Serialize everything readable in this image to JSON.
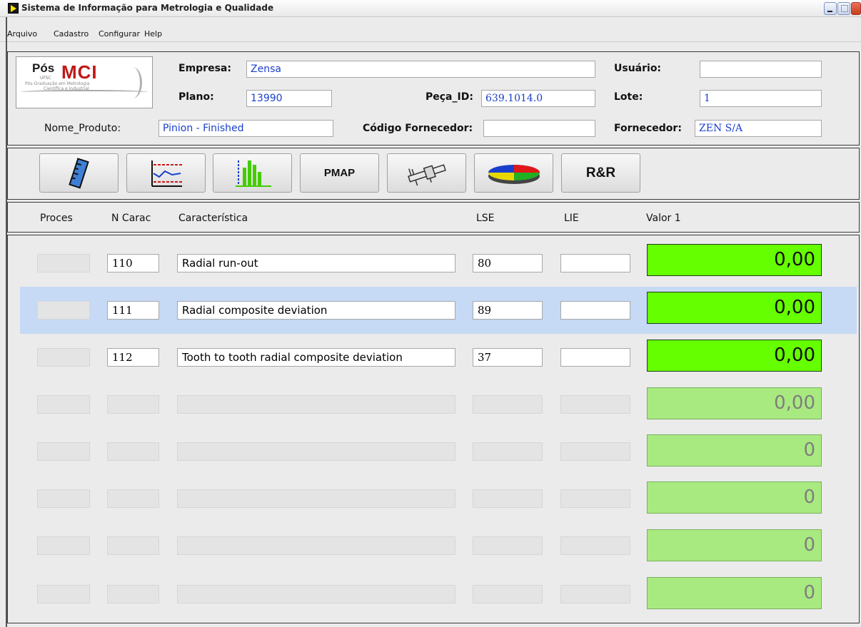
{
  "window": {
    "title": "Sistema de Informação para Metrologia e Qualidade"
  },
  "menu": [
    "Arquivo",
    "Cadastro",
    "Configurar",
    "Help"
  ],
  "logo": {
    "pos": "Pós",
    "mci": "MCI",
    "ufsc": "UFSC",
    "line1": "Pós-Graduação em Metrologia",
    "line2": "Científica e Industrial"
  },
  "header": {
    "empresa_label": "Empresa:",
    "empresa_value": "Zensa",
    "usuario_label": "Usuário:",
    "usuario_value": "",
    "plano_label": "Plano:",
    "plano_value": "13990",
    "peca_label": "Peça_ID:",
    "peca_value": "639.1014.0",
    "lote_label": "Lote:",
    "lote_value": "1",
    "nome_label": "Nome_Produto:",
    "nome_value": "Pinion - Finished",
    "codigo_label": "Código Fornecedor:",
    "codigo_value": "",
    "fornecedor_label": "Fornecedor:",
    "fornecedor_value": "ZEN S/A"
  },
  "toolbar": {
    "ruler_icon": "ruler-icon",
    "control_chart_icon": "control-chart-icon",
    "histogram_icon": "histogram-icon",
    "pmap_label": "PMAP",
    "caliper_icon": "caliper-icon",
    "pie_icon": "pie-chart-icon",
    "rr_label": "R&R"
  },
  "columns": {
    "proces": "Proces",
    "ncarac": "N Carac",
    "caracteristica": "Característica",
    "lse": "LSE",
    "lie": "LIE",
    "valor": "Valor 1"
  },
  "rows": [
    {
      "ncarac": "110",
      "caracteristica": "Radial run-out",
      "lse": "80",
      "lie": "",
      "valor": "0,00"
    },
    {
      "ncarac": "111",
      "caracteristica": "Radial composite deviation",
      "lse": "89",
      "lie": "",
      "valor": "0,00"
    },
    {
      "ncarac": "112",
      "caracteristica": "Tooth to tooth radial composite deviation",
      "lse": "37",
      "lie": "",
      "valor": "0,00"
    },
    {
      "ncarac": "",
      "caracteristica": "",
      "lse": "",
      "lie": "",
      "valor": "0,00"
    },
    {
      "ncarac": "",
      "caracteristica": "",
      "lse": "",
      "lie": "",
      "valor": "0"
    },
    {
      "ncarac": "",
      "caracteristica": "",
      "lse": "",
      "lie": "",
      "valor": "0"
    },
    {
      "ncarac": "",
      "caracteristica": "",
      "lse": "",
      "lie": "",
      "valor": "0"
    },
    {
      "ncarac": "",
      "caracteristica": "",
      "lse": "",
      "lie": "",
      "valor": "0"
    }
  ],
  "colors": {
    "value_active": "#66ff00",
    "value_inactive": "#a8ea80",
    "selected_row": "#c6d9f5",
    "field_text": "#1a3fcc"
  }
}
